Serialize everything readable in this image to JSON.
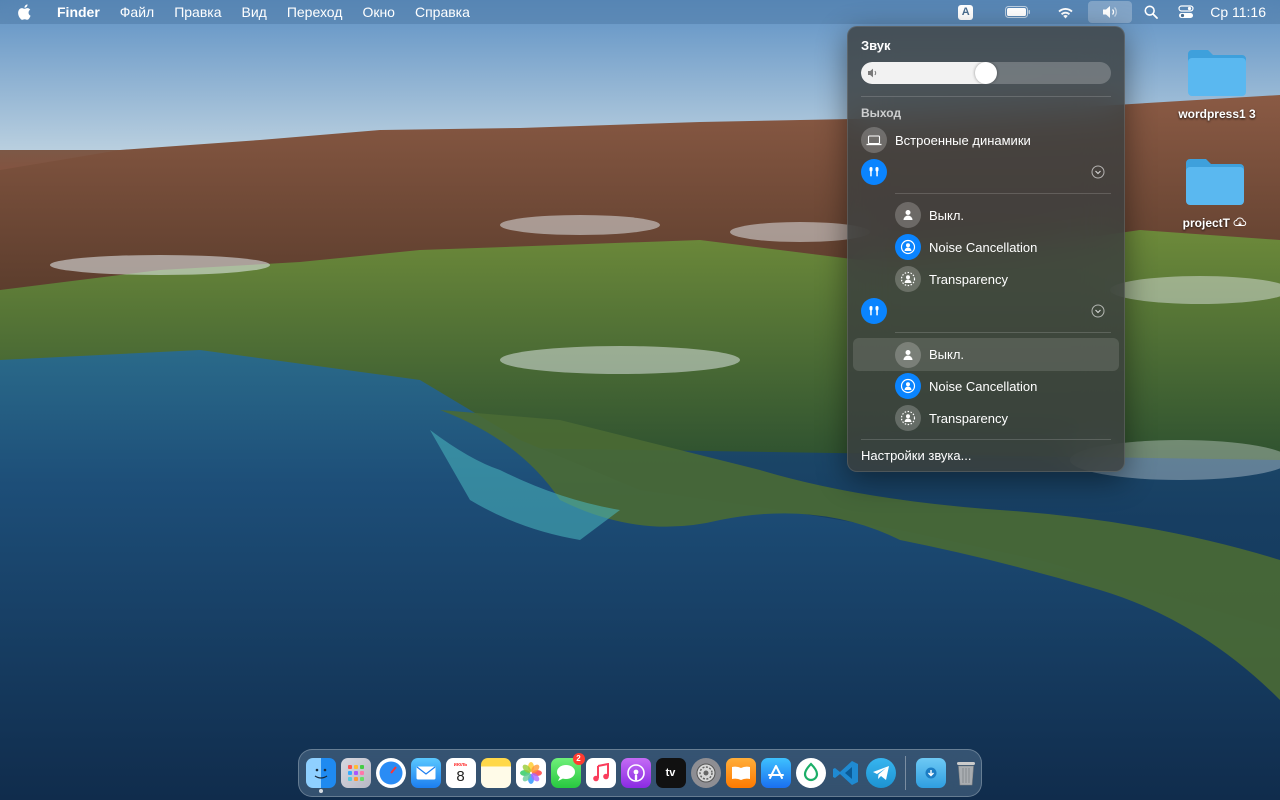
{
  "menubar": {
    "app_name": "Finder",
    "items": [
      "Файл",
      "Правка",
      "Вид",
      "Переход",
      "Окно",
      "Справка"
    ],
    "input_source": "A",
    "clock": "Ср 11:16"
  },
  "sound_panel": {
    "title": "Звук",
    "volume_fraction": 0.5,
    "output_label": "Выход",
    "builtin_device": "Встроенные динамики",
    "airpods_groups": [
      {
        "modes": [
          "Выкл.",
          "Noise Cancellation",
          "Transparency"
        ]
      },
      {
        "modes": [
          "Выкл.",
          "Noise Cancellation",
          "Transparency"
        ]
      }
    ],
    "footer": "Настройки звука..."
  },
  "desktop_icons": [
    {
      "label": "wordpress1 3"
    },
    {
      "label": "projectT"
    }
  ],
  "dock": {
    "apps": [
      "finder",
      "launchpad",
      "safari",
      "mail",
      "calendar",
      "notes",
      "photos",
      "messages",
      "music",
      "podcasts",
      "apple-tv",
      "system-preferences",
      "books",
      "app-store",
      "sourcetree",
      "vscode",
      "telegram"
    ],
    "calendar_month": "июль",
    "calendar_day": "8",
    "messages_badge": "2",
    "tv_label": "tv"
  },
  "colors": {
    "accent": "#0a84ff",
    "folder": "#5ab8f0"
  }
}
